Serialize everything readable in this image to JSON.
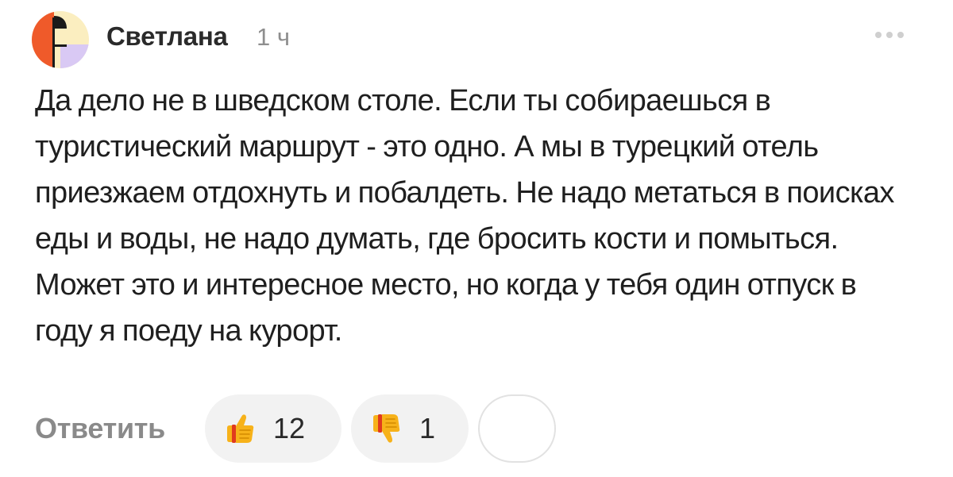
{
  "comment": {
    "author": "Светлана",
    "time_ago": "1 ч",
    "text": "Да дело не в шведском столе. Если ты собираешься в туристический маршрут - это одно. А мы в турецкий отель приезжаем отдохнуть и побалдеть. Не надо метаться в поисках еды и воды, не надо думать, где бросить кости и помыться. Может это и интересное место, но когда у тебя один отпуск в году я поеду на курорт."
  },
  "actions": {
    "reply_label": "Ответить",
    "likes": {
      "icon": "thumbs-up-icon",
      "count": "12"
    },
    "dislikes": {
      "icon": "thumbs-down-icon",
      "count": "1"
    },
    "add_reaction": {
      "icon": "add-reaction-icon"
    }
  },
  "colors": {
    "pill_background": "#f2f2f2",
    "muted_text": "#8a8a8a",
    "body_text": "#1f1f1f",
    "avatar_yellow": "#fbeec0",
    "avatar_orange": "#ef5a2a",
    "avatar_lavender": "#d9c9f4"
  }
}
